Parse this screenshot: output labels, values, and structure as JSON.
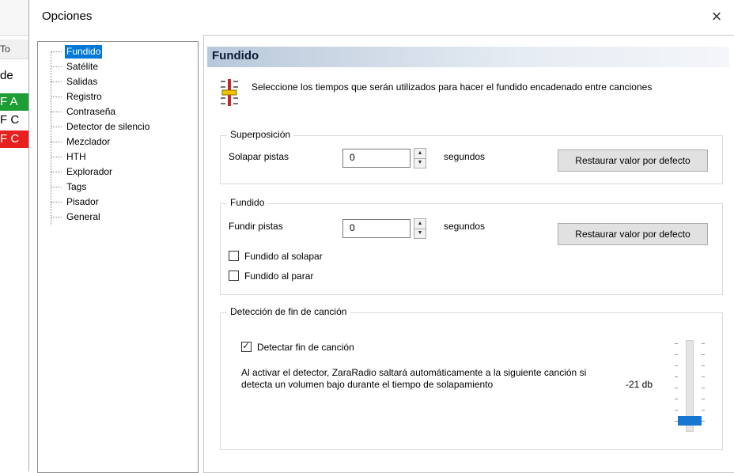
{
  "window": {
    "title": "Opciones",
    "close_glyph": "×"
  },
  "background_app": {
    "rows": [
      "To",
      "de",
      "F A",
      "F C",
      "F C"
    ]
  },
  "tree": {
    "items": [
      "Fundido",
      "Satélite",
      "Salidas",
      "Registro",
      "Contraseña",
      "Detector de silencio",
      "Mezclador",
      "HTH",
      "Explorador",
      "Tags",
      "Pisador",
      "General"
    ],
    "selected": "Fundido"
  },
  "panel": {
    "header": "Fundido",
    "intro_text": "Seleccione los tiempos que serán utilizados para hacer el fundido encadenado entre canciones",
    "superposicion": {
      "title": "Superposición",
      "label": "Solapar pistas",
      "value": "0",
      "unit": "segundos",
      "reset_label": "Restaurar valor por defecto"
    },
    "fundido": {
      "title": "Fundido",
      "label": "Fundir pistas",
      "value": "0",
      "unit": "segundos",
      "reset_label": "Restaurar valor por defecto",
      "chk_solapar": "Fundido al solapar",
      "chk_parar": "Fundido al parar"
    },
    "deteccion": {
      "title": "Detección de fin de canción",
      "chk_label": "Detectar fin de canción",
      "description": "Al activar el detector, ZaraRadio saltará automáticamente a la siguiente canción si detecta un volumen bajo durante el tiempo de solapamiento",
      "level_label": "-21 db"
    }
  }
}
